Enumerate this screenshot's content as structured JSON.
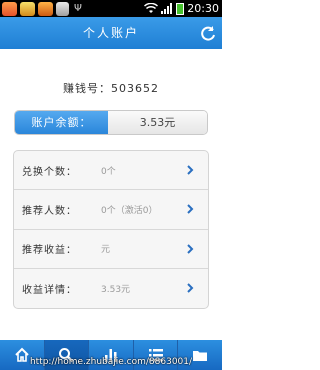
{
  "status_bar": {
    "time": "20:30",
    "notification_icons": [
      "app-notification-icon",
      "app-notification-icon",
      "app-notification-icon",
      "app-notification-icon",
      "usb-icon"
    ],
    "system_icons": [
      "wifi-icon",
      "signal-icon",
      "battery-icon"
    ]
  },
  "header": {
    "title": "个人账户",
    "refresh_icon": "refresh-icon",
    "color": "#2a8be0"
  },
  "account": {
    "label": "赚钱号：",
    "number": "503652"
  },
  "balance": {
    "label": "账户余额：",
    "value": "3.53元"
  },
  "stats": [
    {
      "label": "兑换个数：",
      "value": "0个"
    },
    {
      "label": "推荐人数：",
      "value": "0个（激活0）"
    },
    {
      "label": "推荐收益：",
      "value": "元"
    },
    {
      "label": "收益详情：",
      "value": "3.53元"
    }
  ],
  "tab_bar": {
    "active_index": 1,
    "tabs": [
      {
        "icon": "home-icon"
      },
      {
        "icon": "search-icon"
      },
      {
        "icon": "bar-chart-icon"
      },
      {
        "icon": "list-icon"
      },
      {
        "icon": "folder-icon"
      }
    ]
  },
  "watermark": "http://home.zhubajie.com/8863001/"
}
